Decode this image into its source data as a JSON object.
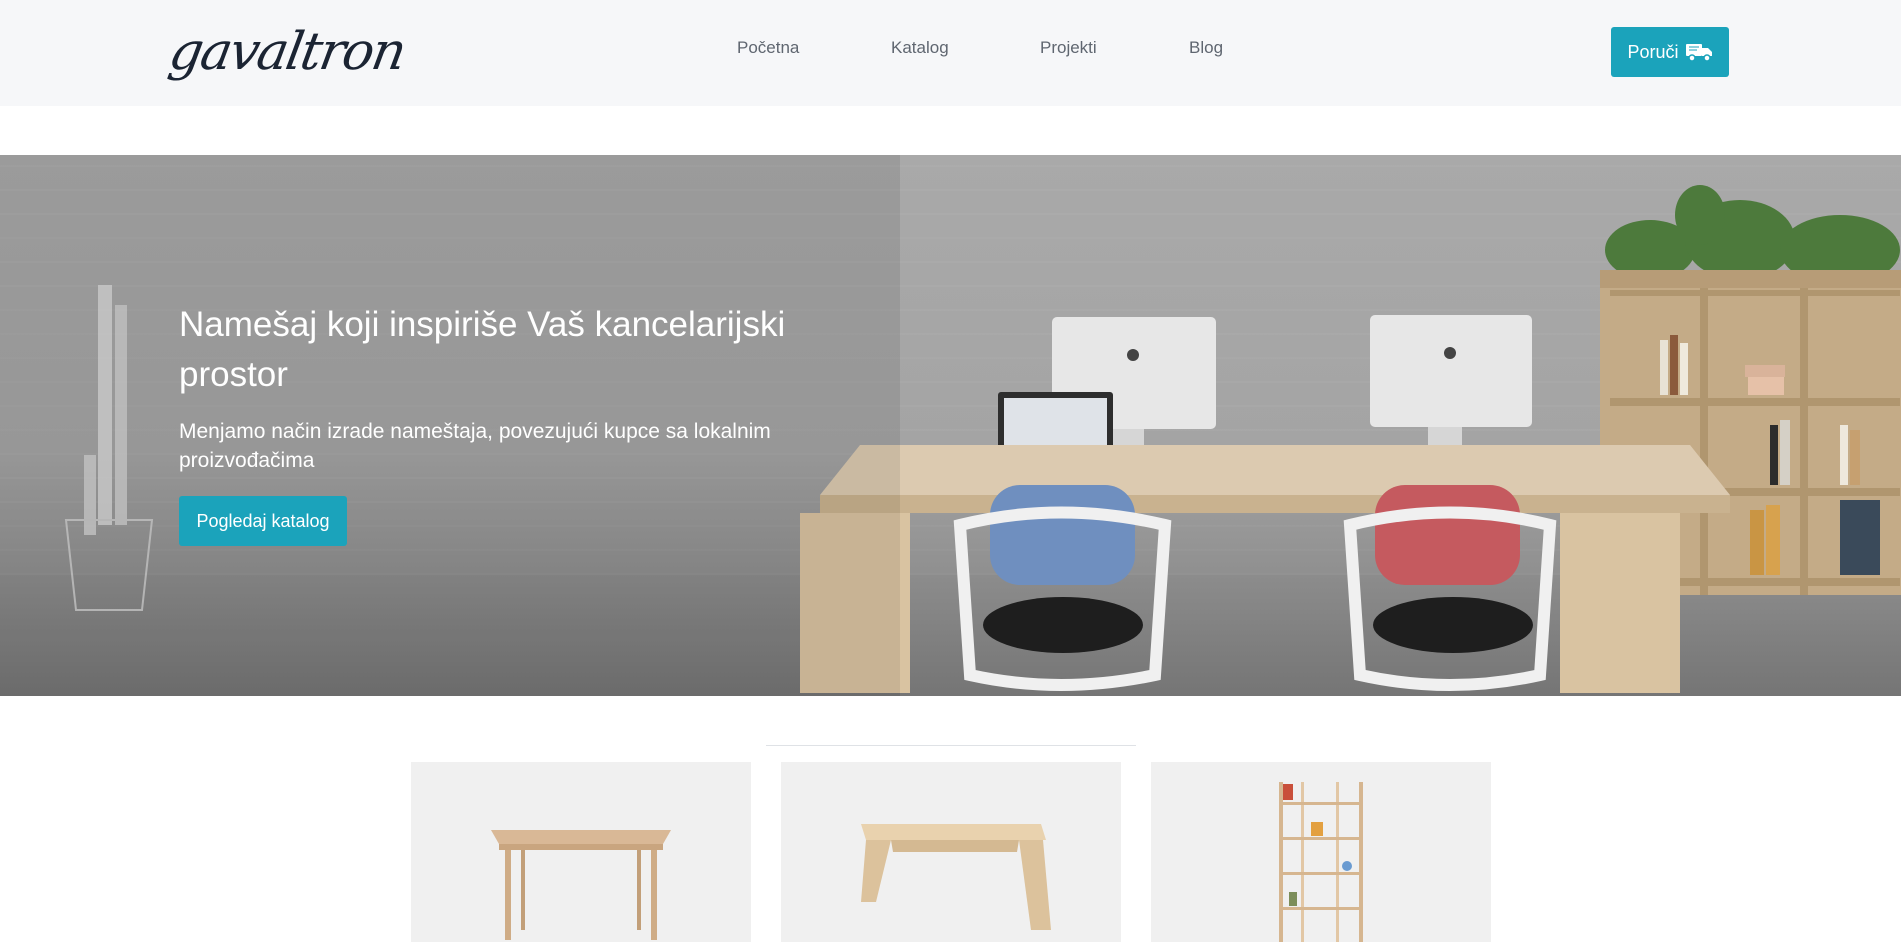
{
  "header": {
    "logo_text": "gavaltron",
    "nav": [
      {
        "label": "Početna"
      },
      {
        "label": "Katalog"
      },
      {
        "label": "Projekti"
      },
      {
        "label": "Blog"
      }
    ],
    "order_button": {
      "label": "Poruči",
      "icon": "truck-icon"
    }
  },
  "hero": {
    "title": "Namešaj koji inspiriše Vaš kancelarijski prostor",
    "subtitle": "Menjamo način izrade nameštaja, povezujući kupce sa lokalnim proizvođačima",
    "button_label": "Pogledaj katalog"
  },
  "products": [
    {
      "name": "desk"
    },
    {
      "name": "bench"
    },
    {
      "name": "bookshelf"
    }
  ],
  "colors": {
    "accent": "#1ba3bb",
    "header_bg": "#f6f7f9",
    "nav_text": "#5f6670",
    "logo": "#1b2433",
    "card_bg": "#f0f0f0"
  }
}
